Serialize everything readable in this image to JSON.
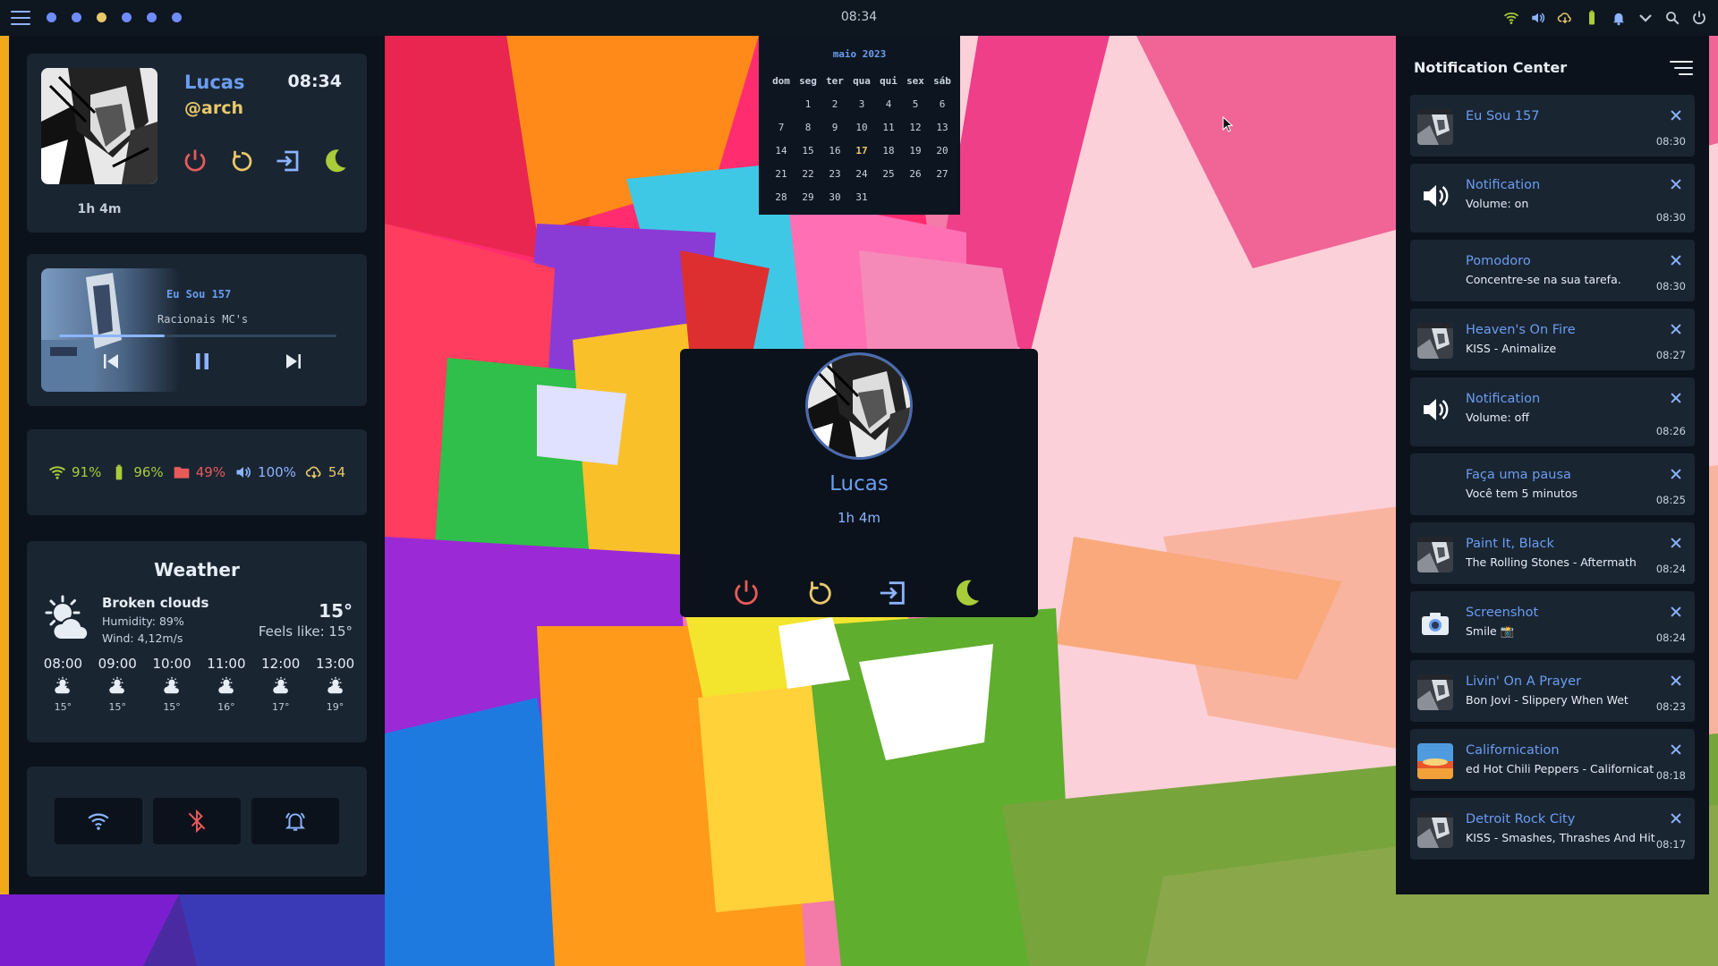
{
  "topbar": {
    "clock": "08:34",
    "workspaces": [
      {
        "active": false
      },
      {
        "active": false
      },
      {
        "active": true
      },
      {
        "active": false
      },
      {
        "active": false
      },
      {
        "active": false
      }
    ],
    "tray_icons": [
      "wifi-icon",
      "volume-icon",
      "cloud-download-icon",
      "battery-icon",
      "bell-icon",
      "chevron-down-icon",
      "search-icon",
      "power-icon"
    ]
  },
  "profile": {
    "name": "Lucas",
    "handle": "@arch",
    "time": "08:34",
    "uptime": "1h 4m"
  },
  "music": {
    "title": "Eu Sou 157",
    "artist": "Racionais MC's",
    "progress": 0.38
  },
  "stats": {
    "wifi": "91%",
    "battery": "96%",
    "disk": "49%",
    "volume": "100%",
    "updates": "54"
  },
  "weather": {
    "title": "Weather",
    "condition": "Broken clouds",
    "humidity": "Humidity: 89%",
    "wind": "Wind: 4,12m/s",
    "temp": "15°",
    "feels_like": "Feels like: 15°",
    "hourly": [
      {
        "time": "08:00",
        "temp": "15°"
      },
      {
        "time": "09:00",
        "temp": "15°"
      },
      {
        "time": "10:00",
        "temp": "15°"
      },
      {
        "time": "11:00",
        "temp": "16°"
      },
      {
        "time": "12:00",
        "temp": "17°"
      },
      {
        "time": "13:00",
        "temp": "19°"
      }
    ]
  },
  "quick_settings": [
    "wifi-icon",
    "bluetooth-off-icon",
    "bell-ring-icon"
  ],
  "calendar": {
    "title": "maio 2023",
    "weekdays": [
      "dom",
      "seg",
      "ter",
      "qua",
      "qui",
      "sex",
      "sáb"
    ],
    "days": [
      "",
      "1",
      "2",
      "3",
      "4",
      "5",
      "6",
      "7",
      "8",
      "9",
      "10",
      "11",
      "12",
      "13",
      "14",
      "15",
      "16",
      "17",
      "18",
      "19",
      "20",
      "21",
      "22",
      "23",
      "24",
      "25",
      "26",
      "27",
      "28",
      "29",
      "30",
      "31"
    ],
    "today": "17"
  },
  "popup": {
    "name": "Lucas",
    "uptime": "1h 4m"
  },
  "notification_center": {
    "title": "Notification Center",
    "items": [
      {
        "title": "Eu Sou 157",
        "body": "",
        "time": "08:30",
        "icon": "album-icon",
        "tall": false
      },
      {
        "title": "Notification",
        "body": "Volume: on",
        "time": "08:30",
        "icon": "volume-icon",
        "tall": true
      },
      {
        "title": "Pomodoro",
        "body": "Concentre-se na sua tarefa.",
        "time": "08:30",
        "icon": "none",
        "tall": false
      },
      {
        "title": "Heaven's On Fire",
        "body": "KISS - Animalize",
        "time": "08:27",
        "icon": "album-icon",
        "tall": false
      },
      {
        "title": "Notification",
        "body": "Volume: off",
        "time": "08:26",
        "icon": "volume-icon",
        "tall": true
      },
      {
        "title": "Faça uma pausa",
        "body": "Você tem 5 minutos",
        "time": "08:25",
        "icon": "none",
        "tall": false
      },
      {
        "title": "Paint It, Black",
        "body": "The Rolling Stones - Aftermath",
        "time": "08:24",
        "icon": "album-icon",
        "tall": false
      },
      {
        "title": "Screenshot",
        "body": "Smile 📸",
        "time": "08:24",
        "icon": "camera-icon",
        "tall": false
      },
      {
        "title": "Livin' On A Prayer",
        "body": "Bon Jovi - Slippery When Wet",
        "time": "08:23",
        "icon": "album-icon",
        "tall": false
      },
      {
        "title": "Californication",
        "body": "ed Hot Chili Peppers - Californicat",
        "time": "08:18",
        "icon": "album-orange-icon",
        "tall": false
      },
      {
        "title": "Detroit Rock City",
        "body": "KISS - Smashes, Thrashes And Hit",
        "time": "08:17",
        "icon": "album-icon",
        "tall": false
      }
    ]
  },
  "colors": {
    "accent_blue": "#6a9df0",
    "accent_yellow": "#e8c86a",
    "accent_red": "#e85a5a",
    "accent_green": "#a8cc3a",
    "panel_bg": "#0b121b",
    "card_bg": "#1a2532"
  }
}
